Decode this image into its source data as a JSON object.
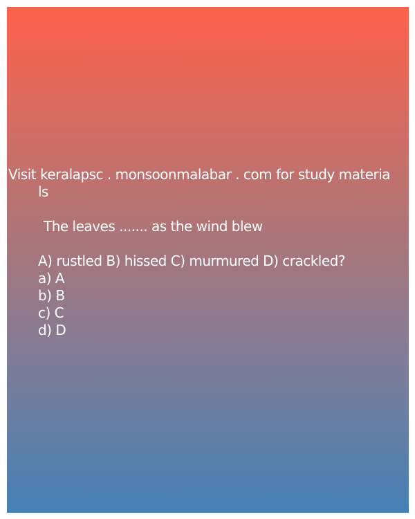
{
  "source_line_1": "Visit keralapsc . monsoonmalabar . com for study materia",
  "source_line_2": "ls",
  "question": "The leaves ....... as the wind blew",
  "options_line": "A) rustled  B) hissed  C) murmured  D) crackled?",
  "answers": [
    "a) A",
    "b) B",
    "c) C",
    "d) D"
  ],
  "colors": {
    "gradient_top": "#fe624c",
    "gradient_mid": "#b17476",
    "gradient_bottom": "#4580b5",
    "text": "#ffffff"
  }
}
